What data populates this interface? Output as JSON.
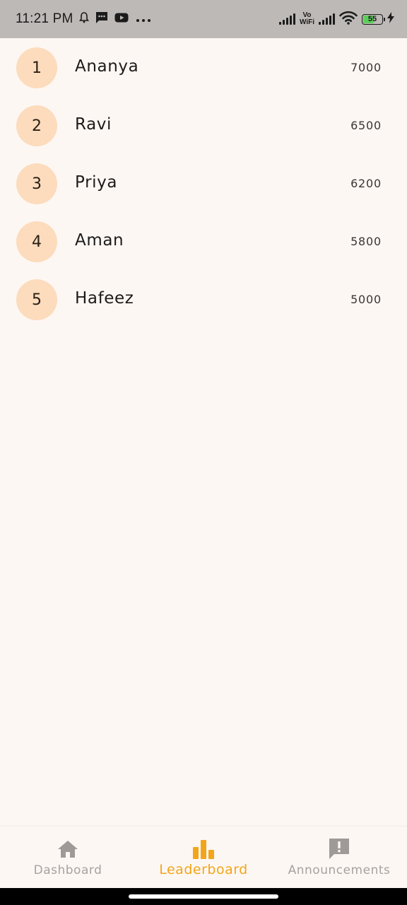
{
  "status_bar": {
    "time": "11:21 PM",
    "vowifi_top": "Vo",
    "vowifi_bottom": "WiFi",
    "battery_level": "55",
    "battery_fraction": 0.55
  },
  "leaderboard": [
    {
      "rank": "1",
      "name": "Ananya",
      "score": "7000"
    },
    {
      "rank": "2",
      "name": "Ravi",
      "score": "6500"
    },
    {
      "rank": "3",
      "name": "Priya",
      "score": "6200"
    },
    {
      "rank": "4",
      "name": "Aman",
      "score": "5800"
    },
    {
      "rank": "5",
      "name": "Hafeez",
      "score": "5000"
    }
  ],
  "bottom_nav": {
    "items": [
      {
        "label": "Dashboard",
        "icon": "home-icon",
        "active": false
      },
      {
        "label": "Leaderboard",
        "icon": "bar-chart-icon",
        "active": true
      },
      {
        "label": "Announcements",
        "icon": "announcement-icon",
        "active": false
      }
    ]
  },
  "colors": {
    "background": "#fdf7f4",
    "rank_circle": "#fcdcbc",
    "active_nav": "#f3a519",
    "inactive_nav": "#a6a2a0"
  }
}
